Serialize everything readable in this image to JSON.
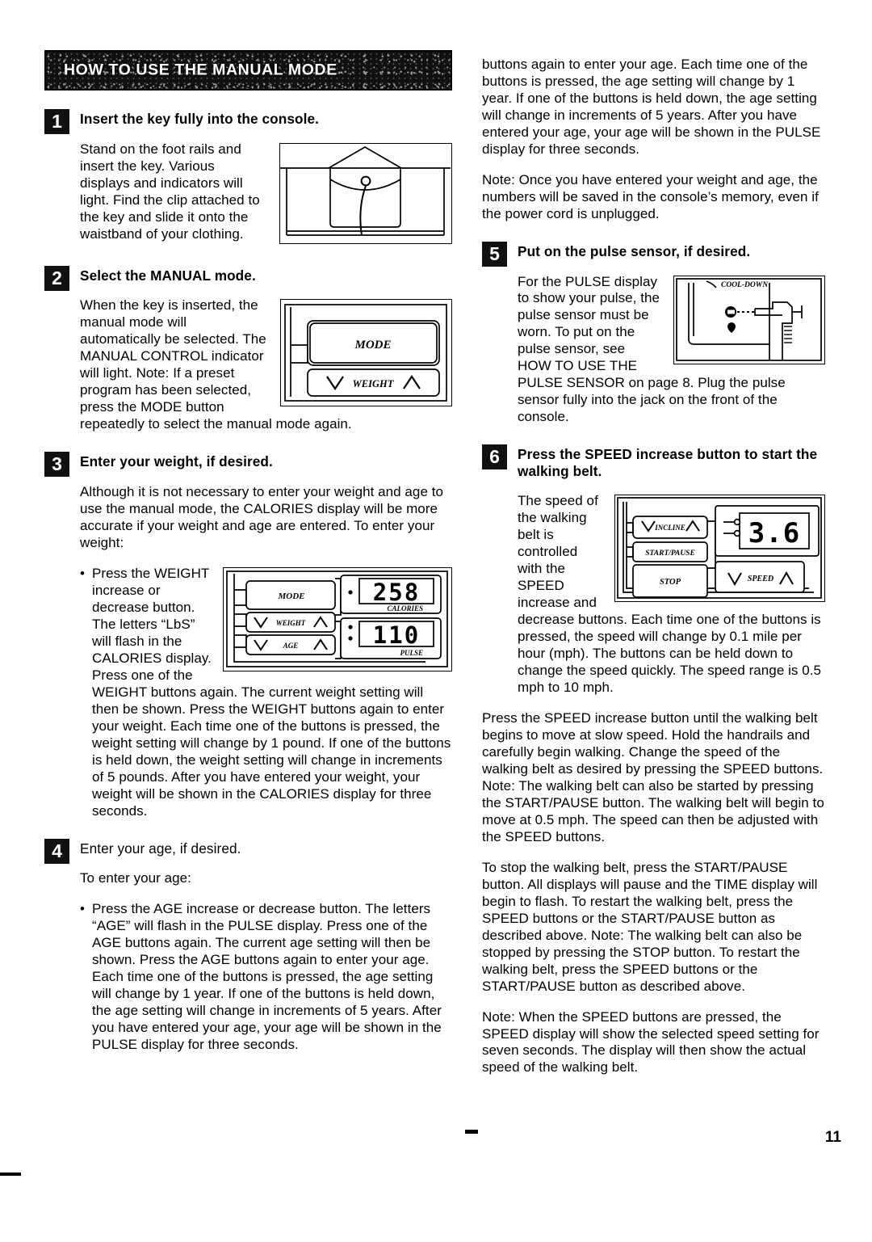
{
  "page": {
    "number": "11",
    "section_title": "HOW TO USE THE MANUAL MODE"
  },
  "steps": [
    {
      "num": "1",
      "heading": "Insert the key fully into the console.",
      "body": "Stand on the foot rails and insert the key. Various displays and indicators will light. Find the clip attached to the key and slide it onto the waistband of your clothing."
    },
    {
      "num": "2",
      "heading": "Select the MANUAL mode.",
      "body": "When the key is inserted, the manual mode will automatically be selected. The MANUAL CONTROL indicator will light. Note: If a preset program has been selected, press the MODE button repeatedly to select the manual mode again."
    },
    {
      "num": "3",
      "heading": "Enter your weight, if desired.",
      "intro": "Although it is not necessary to enter your weight and age to use the manual mode, the CALORIES display will be more accurate if your weight and age are entered. To enter your weight:",
      "bullet": "Press the WEIGHT increase or decrease button. The letters “LbS” will flash in the CALORIES display. Press one of the WEIGHT buttons again. The current weight setting will then be shown. Press the WEIGHT buttons again to enter your weight. Each time one of the buttons is pressed, the weight setting will change by 1 pound. If one of the buttons is held down, the weight setting will change in increments of 5 pounds. After you have entered your weight, your weight will be shown in the CALORIES display for three seconds."
    },
    {
      "num": "4",
      "heading": "Enter your age, if desired.",
      "intro": "To enter your age:",
      "bullet": "Press the AGE increase or decrease button. The letters “AGE” will flash in the PULSE display. Press one of the AGE buttons again. The current age setting will then be shown. Press the AGE buttons again to enter your age. Each time one of the buttons is pressed, the age setting will change by 1 year. If one of the buttons is held down, the age setting will change in increments of 5 years. After you have entered your age, your age will be shown in the PULSE display for three seconds.",
      "note": "Note: Once you have entered your weight and age, the numbers will be saved in the console’s memory, even if the power cord is unplugged."
    },
    {
      "num": "5",
      "heading": "Put on the pulse sensor, if desired.",
      "body": "For the PULSE display to show your pulse, the pulse sensor must be worn. To put on the pulse sensor, see HOW TO USE THE PULSE SENSOR on page 8. Plug the pulse sensor fully into the jack on the front of the console."
    },
    {
      "num": "6",
      "heading": "Press the SPEED increase button to start the walking belt.",
      "body": "The speed of the walking belt is controlled with the SPEED increase and decrease buttons. Each time one of the buttons is pressed, the speed will change by 0.1 mile per hour (mph). The buttons can be held down to change the speed quickly. The speed range is 0.5 mph to 10 mph.",
      "para2": "Press the SPEED increase button until the walking belt begins to move at slow speed. Hold the handrails and carefully begin walking. Change the speed of the walking belt as desired by pressing the SPEED buttons. Note: The walking belt can also be started by pressing the START/PAUSE button. The walking belt will begin to move at 0.5 mph. The speed can then be adjusted with the SPEED buttons.",
      "para3": "To stop the walking belt, press the START/PAUSE button. All displays will pause and the TIME display will begin to flash. To restart the walking belt, press the SPEED buttons or the START/PAUSE button as described above. Note: The walking belt can also be stopped by pressing the STOP button. To restart the walking belt, press the SPEED buttons or the START/PAUSE button as described above.",
      "para4": "Note: When the SPEED buttons are pressed, the SPEED display will show the selected speed setting for seven seconds. The display will then show the actual speed of the walking belt."
    }
  ],
  "figures": {
    "key_clip": {
      "caption": ""
    },
    "mode_panel": {
      "mode_button": "MODE",
      "weight_button": "WEIGHT"
    },
    "weight_age_panel": {
      "mode_button": "MODE",
      "weight_button": "WEIGHT",
      "age_button": "AGE",
      "calories_label": "CALORIES",
      "calories_value": "258",
      "pulse_label": "PULSE",
      "pulse_value": "110"
    },
    "pulse_jack": {
      "cooldown_label": "COOL-DOWN"
    },
    "speed_panel": {
      "top_button": "INCLINE",
      "start_pause_button": "START/PAUSE",
      "stop_button": "STOP",
      "speed_button": "SPEED",
      "speed_value": "3.6"
    }
  }
}
